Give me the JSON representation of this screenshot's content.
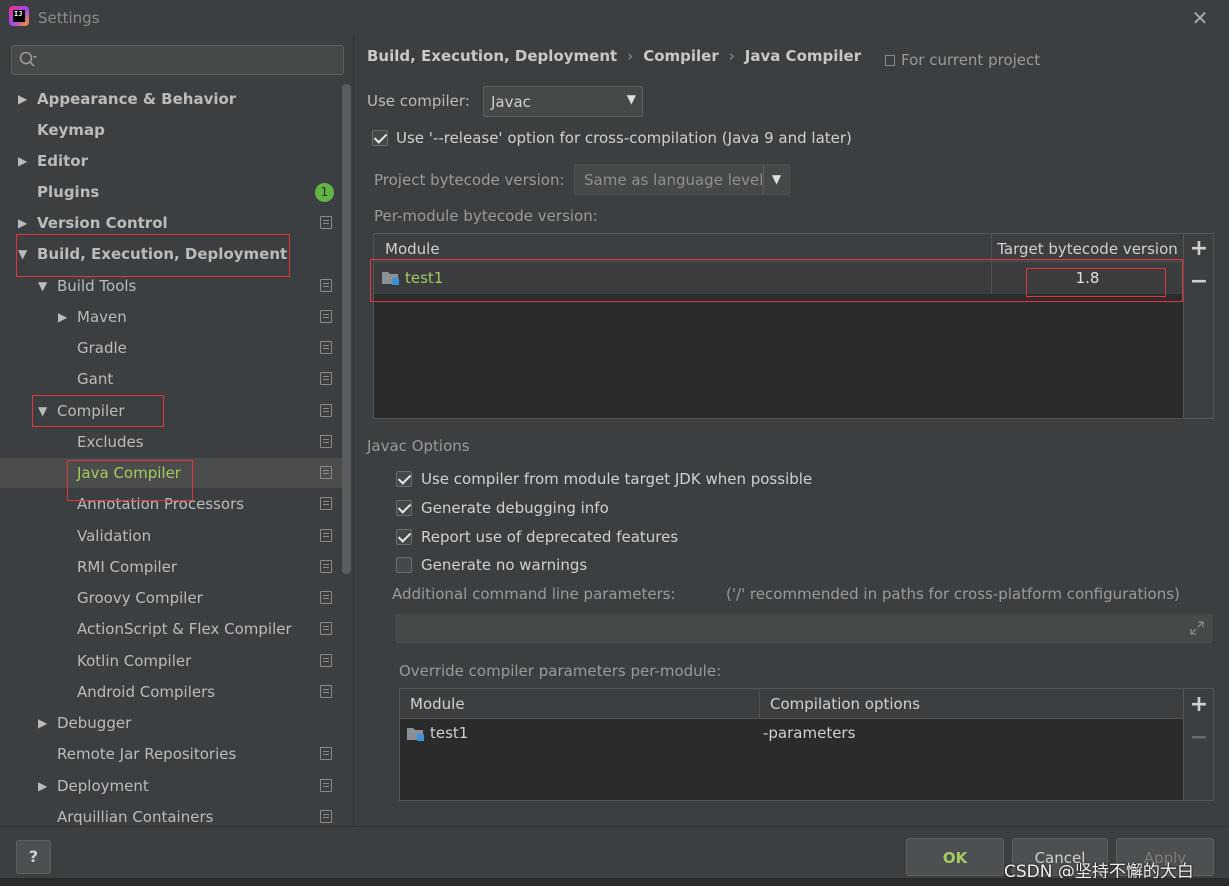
{
  "window": {
    "title": "Settings",
    "logo_text": "IJ"
  },
  "sidebar": {
    "search_placeholder": "",
    "items": [
      {
        "label": "Appearance & Behavior"
      },
      {
        "label": "Keymap"
      },
      {
        "label": "Editor"
      },
      {
        "label": "Plugins",
        "badge": "1"
      },
      {
        "label": "Version Control"
      },
      {
        "label": "Build, Execution, Deployment"
      },
      {
        "label": "Build Tools"
      },
      {
        "label": "Maven"
      },
      {
        "label": "Gradle"
      },
      {
        "label": "Gant"
      },
      {
        "label": "Compiler"
      },
      {
        "label": "Excludes"
      },
      {
        "label": "Java Compiler",
        "selected": true
      },
      {
        "label": "Annotation Processors"
      },
      {
        "label": "Validation"
      },
      {
        "label": "RMI Compiler"
      },
      {
        "label": "Groovy Compiler"
      },
      {
        "label": "ActionScript & Flex Compiler"
      },
      {
        "label": "Kotlin Compiler"
      },
      {
        "label": "Android Compilers"
      },
      {
        "label": "Debugger"
      },
      {
        "label": "Remote Jar Repositories"
      },
      {
        "label": "Deployment"
      },
      {
        "label": "Arquillian Containers"
      }
    ]
  },
  "breadcrumb": {
    "part1": "Build, Execution, Deployment",
    "part2": "Compiler",
    "part3": "Java Compiler",
    "separator": "›"
  },
  "scope_label": "For current project",
  "use_compiler": {
    "label": "Use compiler:",
    "value": "Javac"
  },
  "release_option": {
    "label": "Use '--release' option for cross-compilation (Java 9 and later)",
    "checked": true
  },
  "project_bytecode": {
    "label": "Project bytecode version:",
    "value": "Same as language level"
  },
  "per_module": {
    "label": "Per-module bytecode version:",
    "headers": [
      "Module",
      "Target bytecode version"
    ],
    "rows": [
      {
        "module": "test1",
        "target": "1.8"
      }
    ],
    "add": "+",
    "remove": "−"
  },
  "javac_options": {
    "label": "Javac Options",
    "checkboxes": [
      {
        "label": "Use compiler from module target JDK when possible",
        "checked": true
      },
      {
        "label": "Generate debugging info",
        "checked": true
      },
      {
        "label": "Report use of deprecated features",
        "checked": true
      },
      {
        "label": "Generate no warnings",
        "checked": false
      }
    ],
    "cmdline_label": "Additional command line parameters:",
    "cmdline_hint": "('/' recommended in paths for cross-platform configurations)",
    "cmdline_value": ""
  },
  "override": {
    "label": "Override compiler parameters per-module:",
    "headers": [
      "Module",
      "Compilation options"
    ],
    "rows": [
      {
        "module": "test1",
        "options": "-parameters"
      }
    ],
    "add": "+",
    "remove": "−"
  },
  "footer": {
    "help": "?",
    "ok": "OK",
    "cancel": "Cancel",
    "apply": "Apply",
    "watermark": "CSDN @坚持不懈的大白"
  },
  "colors": {
    "accent_green": "#a7c95e",
    "highlight_red": "#e0353a",
    "badge_green": "#62b543"
  }
}
